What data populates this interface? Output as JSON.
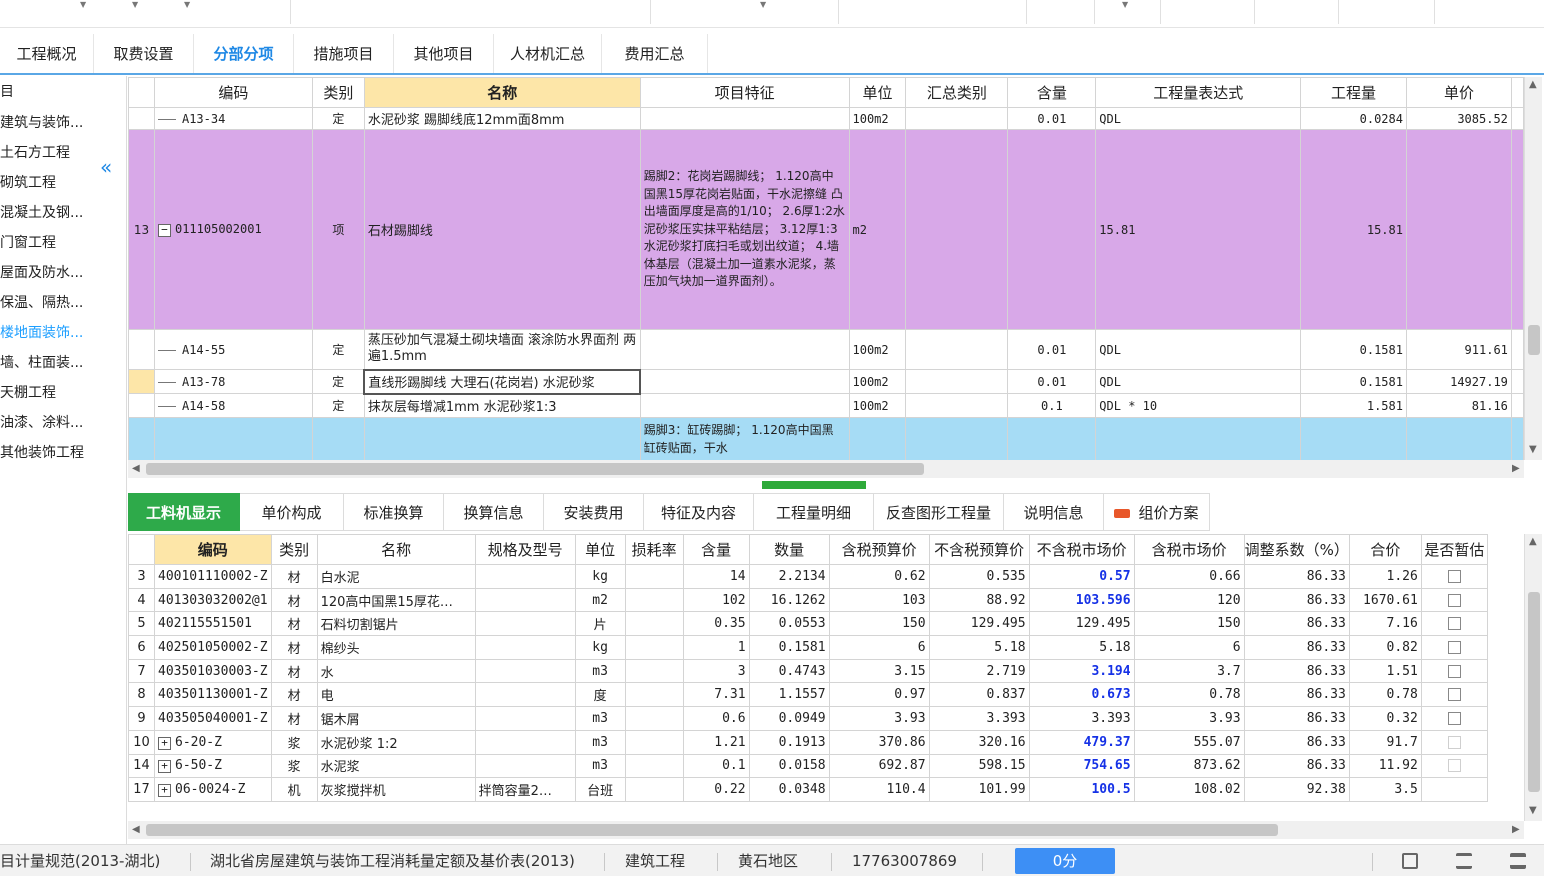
{
  "main_tabs": [
    "工程概况",
    "取费设置",
    "分部分项",
    "措施项目",
    "其他项目",
    "人材机汇总",
    "费用汇总"
  ],
  "active_main_tab": "分部分项",
  "tree": {
    "items": [
      "目",
      "建筑与装饰...",
      "土石方工程",
      "砌筑工程",
      "混凝土及钢...",
      "门窗工程",
      "屋面及防水...",
      "保温、隔热...",
      "楼地面装饰...",
      "墙、柱面装...",
      "天棚工程",
      "油漆、涂料...",
      "其他装饰工程"
    ],
    "active": "楼地面装饰..."
  },
  "upper_grid": {
    "headers": [
      "编码",
      "类别",
      "名称",
      "项目特征",
      "单位",
      "汇总类别",
      "含量",
      "工程量表达式",
      "工程量",
      "单价"
    ],
    "rows": [
      {
        "num": "",
        "code": "A13-34",
        "type": "定",
        "name": "水泥砂浆 踢脚线底12mm面8mm",
        "feature": "",
        "unit": "100m2",
        "summary": "",
        "content": "0.01",
        "expr": "QDL",
        "qty": "0.0284",
        "price": "3085.52"
      },
      {
        "num": "13",
        "code": "011105002001",
        "type": "项",
        "name": "石材踢脚线",
        "feature": "踢脚2：花岗岩踢脚线；\n1.120高中国黑15厚花岗岩贴面，干水泥擦缝 凸出墙面厚度是高的1/10；\n2.6厚1:2水泥砂浆压实抹平粘结层；\n3.12厚1:3水泥砂浆打底扫毛或划出纹道；\n4.墙体基层（混凝土加一道素水泥浆，蒸压加气块加一道界面剂）。",
        "unit": "m2",
        "summary": "",
        "content": "",
        "expr": "15.81",
        "qty": "15.81",
        "price": ""
      },
      {
        "num": "",
        "code": "A14-55",
        "type": "定",
        "name": "蒸压砂加气混凝土砌块墙面 滚涂防水界面剂 两遍1.5mm",
        "feature": "",
        "unit": "100m2",
        "summary": "",
        "content": "0.01",
        "expr": "QDL",
        "qty": "0.1581",
        "price": "911.61"
      },
      {
        "num": "",
        "code": "A13-78",
        "type": "定",
        "name": "直线形踢脚线 大理石(花岗岩) 水泥砂浆",
        "feature": "",
        "unit": "100m2",
        "summary": "",
        "content": "0.01",
        "expr": "QDL",
        "qty": "0.1581",
        "price": "14927.19"
      },
      {
        "num": "",
        "code": "A14-58",
        "type": "定",
        "name": "抹灰层每增减1mm 水泥砂浆1:3",
        "feature": "",
        "unit": "100m2",
        "summary": "",
        "content": "0.1",
        "expr": "QDL * 10",
        "qty": "1.581",
        "price": "81.16"
      },
      {
        "num": "",
        "code": "",
        "type": "",
        "name": "",
        "feature": "踢脚3：缸砖踢脚；\n1.120高中国黑缸砖贴面，干水",
        "unit": "",
        "summary": "",
        "content": "",
        "expr": "",
        "qty": "",
        "price": ""
      }
    ]
  },
  "lower_tabs": [
    "工料机显示",
    "单价构成",
    "标准换算",
    "换算信息",
    "安装费用",
    "特征及内容",
    "工程量明细",
    "反查图形工程量",
    "说明信息",
    "组价方案"
  ],
  "active_lower_tab": "工料机显示",
  "lower_grid": {
    "headers": [
      "编码",
      "类别",
      "名称",
      "规格及型号",
      "单位",
      "损耗率",
      "含量",
      "数量",
      "含税预算价",
      "不含税预算价",
      "不含税市场价",
      "含税市场价",
      "调整系数（%）",
      "合价",
      "是否暂估"
    ],
    "rows": [
      {
        "num": "3",
        "expand": false,
        "code": "400101110002-Z",
        "type": "材",
        "name": "白水泥",
        "spec": "",
        "unit": "kg",
        "loss": "",
        "content": "14",
        "qty": "2.2134",
        "tax_budget": "0.62",
        "notax_budget": "0.535",
        "notax_market": "0.57",
        "market_blue": true,
        "tax_market": "0.66",
        "coef": "86.33",
        "total": "1.26",
        "chk": "normal"
      },
      {
        "num": "4",
        "expand": false,
        "code": "401303032002@1",
        "type": "材",
        "name": "120高中国黑15厚花…",
        "spec": "",
        "unit": "m2",
        "loss": "",
        "content": "102",
        "qty": "16.1262",
        "tax_budget": "103",
        "notax_budget": "88.92",
        "notax_market": "103.596",
        "market_blue": true,
        "tax_market": "120",
        "coef": "86.33",
        "total": "1670.61",
        "chk": "normal"
      },
      {
        "num": "5",
        "expand": false,
        "code": "402115551501",
        "type": "材",
        "name": "石料切割锯片",
        "spec": "",
        "unit": "片",
        "loss": "",
        "content": "0.35",
        "qty": "0.0553",
        "tax_budget": "150",
        "notax_budget": "129.495",
        "notax_market": "129.495",
        "market_blue": false,
        "tax_market": "150",
        "coef": "86.33",
        "total": "7.16",
        "chk": "normal"
      },
      {
        "num": "6",
        "expand": false,
        "code": "402501050002-Z",
        "type": "材",
        "name": "棉纱头",
        "spec": "",
        "unit": "kg",
        "loss": "",
        "content": "1",
        "qty": "0.1581",
        "tax_budget": "6",
        "notax_budget": "5.18",
        "notax_market": "5.18",
        "market_blue": false,
        "tax_market": "6",
        "coef": "86.33",
        "total": "0.82",
        "chk": "normal"
      },
      {
        "num": "7",
        "expand": false,
        "code": "403501030003-Z",
        "type": "材",
        "name": "水",
        "spec": "",
        "unit": "m3",
        "loss": "",
        "content": "3",
        "qty": "0.4743",
        "tax_budget": "3.15",
        "notax_budget": "2.719",
        "notax_market": "3.194",
        "market_blue": true,
        "tax_market": "3.7",
        "coef": "86.33",
        "total": "1.51",
        "chk": "normal"
      },
      {
        "num": "8",
        "expand": false,
        "code": "403501130001-Z",
        "type": "材",
        "name": "电",
        "spec": "",
        "unit": "度",
        "loss": "",
        "content": "7.31",
        "qty": "1.1557",
        "tax_budget": "0.97",
        "notax_budget": "0.837",
        "notax_market": "0.673",
        "market_blue": true,
        "tax_market": "0.78",
        "coef": "86.33",
        "total": "0.78",
        "chk": "normal"
      },
      {
        "num": "9",
        "expand": false,
        "code": "403505040001-Z",
        "type": "材",
        "name": "锯木屑",
        "spec": "",
        "unit": "m3",
        "loss": "",
        "content": "0.6",
        "qty": "0.0949",
        "tax_budget": "3.93",
        "notax_budget": "3.393",
        "notax_market": "3.393",
        "market_blue": false,
        "tax_market": "3.93",
        "coef": "86.33",
        "total": "0.32",
        "chk": "normal"
      },
      {
        "num": "10",
        "expand": true,
        "code": "6-20-Z",
        "type": "浆",
        "name": "水泥砂浆 1:2",
        "spec": "",
        "unit": "m3",
        "loss": "",
        "content": "1.21",
        "qty": "0.1913",
        "tax_budget": "370.86",
        "notax_budget": "320.16",
        "notax_market": "479.37",
        "market_blue": true,
        "tax_market": "555.07",
        "coef": "86.33",
        "total": "91.7",
        "chk": "dim"
      },
      {
        "num": "14",
        "expand": true,
        "code": "6-50-Z",
        "type": "浆",
        "name": "水泥浆",
        "spec": "",
        "unit": "m3",
        "loss": "",
        "content": "0.1",
        "qty": "0.0158",
        "tax_budget": "692.87",
        "notax_budget": "598.15",
        "notax_market": "754.65",
        "market_blue": true,
        "tax_market": "873.62",
        "coef": "86.33",
        "total": "11.92",
        "chk": "dim"
      },
      {
        "num": "17",
        "expand": true,
        "code": "06-0024-Z",
        "type": "机",
        "name": "灰浆搅拌机",
        "spec": "拌筒容量2…",
        "unit": "台班",
        "loss": "",
        "content": "0.22",
        "qty": "0.0348",
        "tax_budget": "110.4",
        "notax_budget": "101.99",
        "notax_market": "100.5",
        "market_blue": true,
        "tax_market": "108.02",
        "coef": "92.38",
        "total": "3.5",
        "chk": "none"
      }
    ]
  },
  "status_bar": {
    "standard": "目计量规范(2013-湖北)",
    "quota": "湖北省房屋建筑与装饰工程消耗量定额及基价表(2013)",
    "profession": "建筑工程",
    "region": "黄石地区",
    "phone": "17763007869",
    "score": "0分"
  },
  "icons": {
    "collapse": "double-chevron-left-icon",
    "expand_box": "plus-box-icon",
    "collapse_box": "minus-box-icon",
    "new_badge": "new-badge-icon"
  },
  "colors": {
    "accent": "#1e88e5",
    "active_lower_tab": "#2eaa4a",
    "purple_row": "#d8a8e8",
    "cyan_row": "#a6dcf5",
    "header_highlight": "#fde6a8",
    "blue_value": "#1531e6",
    "score_button": "#3d8ff5"
  }
}
